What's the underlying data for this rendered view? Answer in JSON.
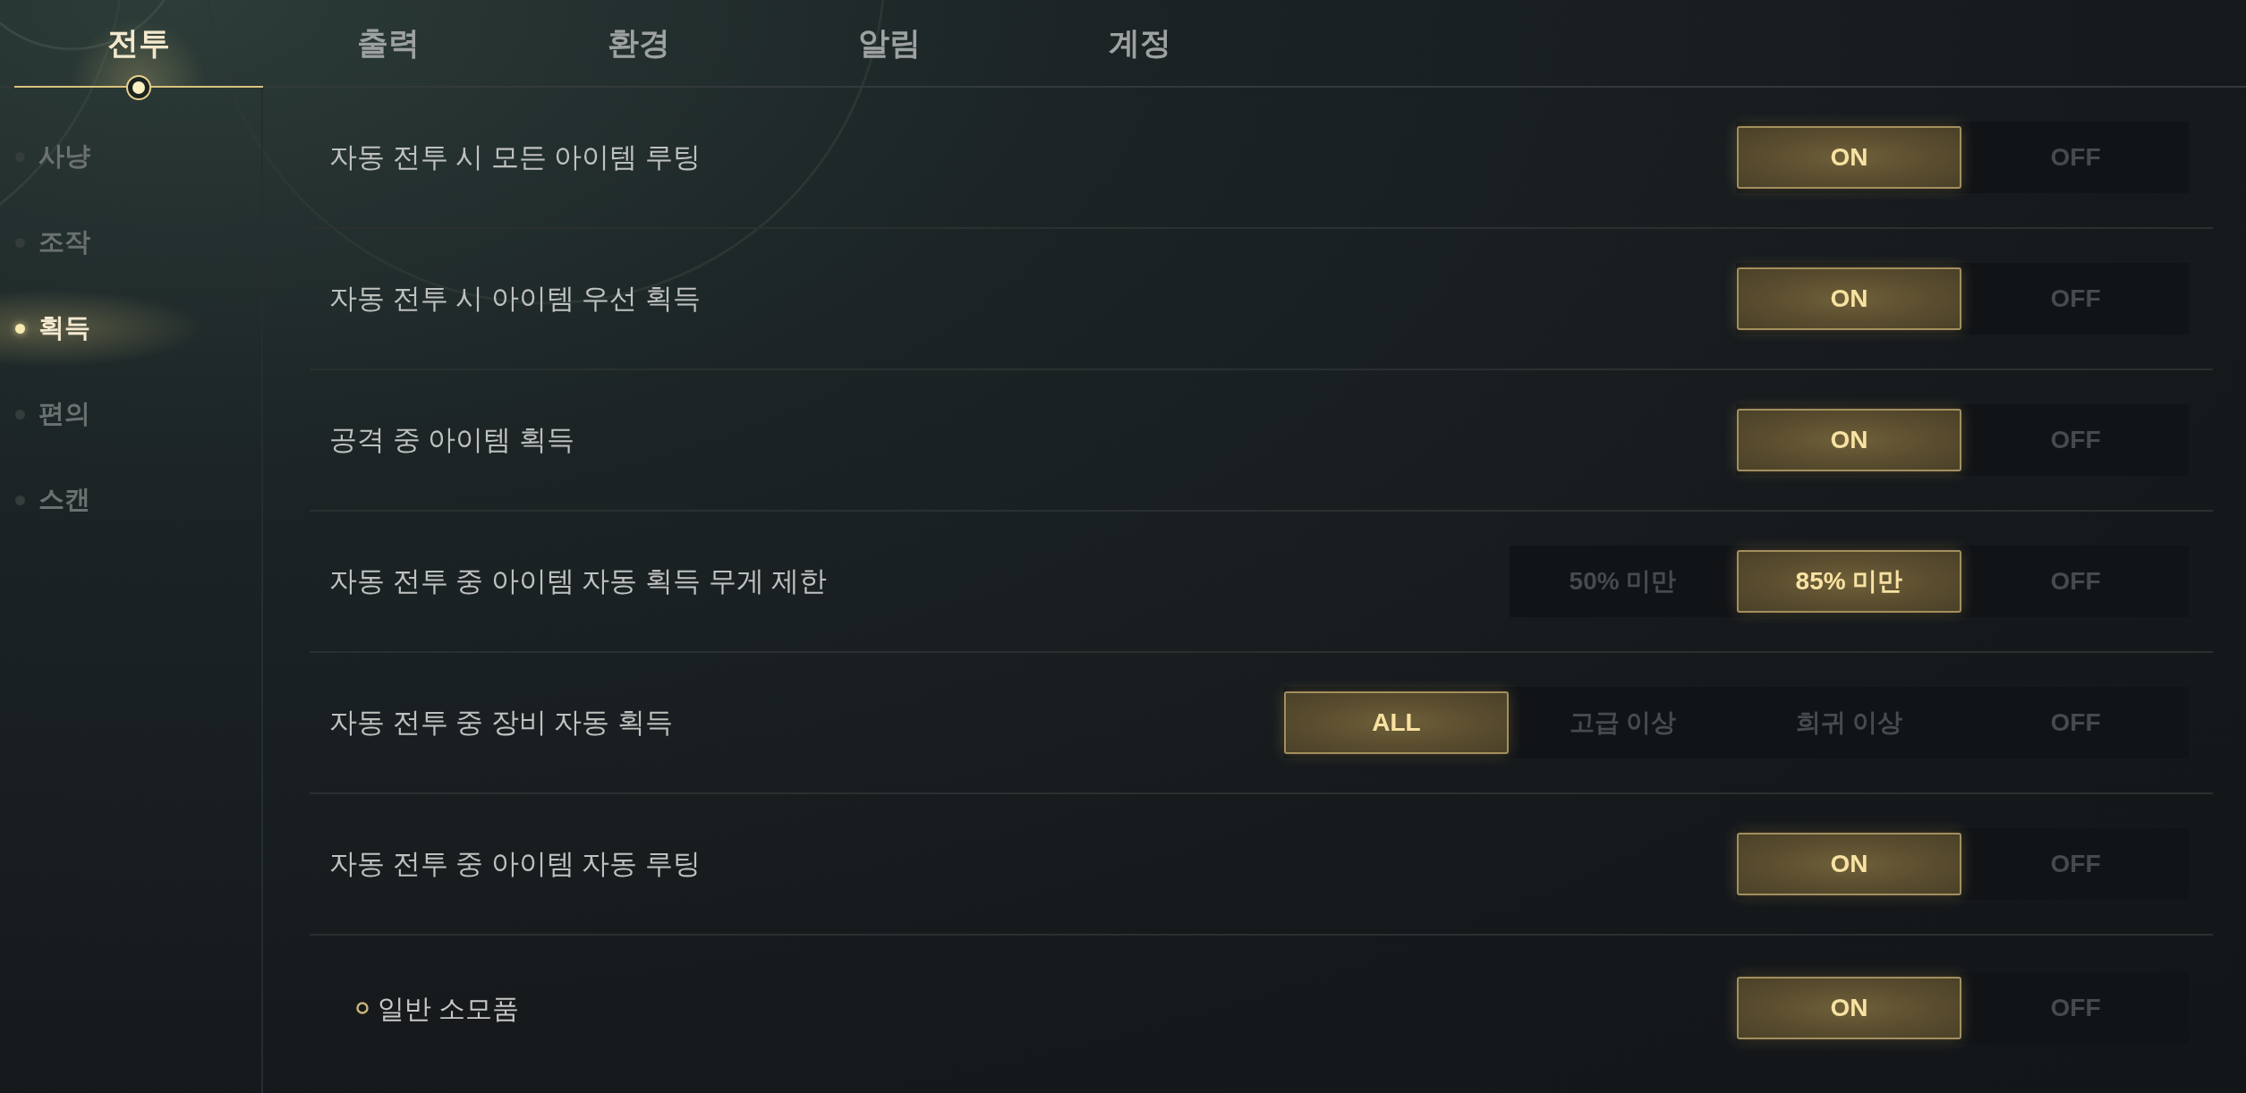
{
  "tabs": [
    {
      "label": "전투",
      "selected": true
    },
    {
      "label": "출력",
      "selected": false
    },
    {
      "label": "환경",
      "selected": false
    },
    {
      "label": "알림",
      "selected": false
    },
    {
      "label": "계정",
      "selected": false
    }
  ],
  "sidebar": {
    "items": [
      {
        "label": "사냥",
        "selected": false
      },
      {
        "label": "조작",
        "selected": false
      },
      {
        "label": "획득",
        "selected": true
      },
      {
        "label": "편의",
        "selected": false
      },
      {
        "label": "스캔",
        "selected": false
      }
    ]
  },
  "settings": [
    {
      "kind": "main",
      "label": "자동 전투 시 모든 아이템 루팅",
      "options": [
        {
          "label": "ON",
          "selected": true
        },
        {
          "label": "OFF",
          "selected": false
        }
      ]
    },
    {
      "kind": "main",
      "label": "자동 전투 시 아이템 우선 획득",
      "options": [
        {
          "label": "ON",
          "selected": true
        },
        {
          "label": "OFF",
          "selected": false
        }
      ]
    },
    {
      "kind": "main",
      "label": "공격 중 아이템 획득",
      "options": [
        {
          "label": "ON",
          "selected": true
        },
        {
          "label": "OFF",
          "selected": false
        }
      ]
    },
    {
      "kind": "main",
      "label": "자동 전투 중 아이템 자동 획득 무게 제한",
      "options": [
        {
          "label": "50% 미만",
          "selected": false
        },
        {
          "label": "85% 미만",
          "selected": true
        },
        {
          "label": "OFF",
          "selected": false
        }
      ]
    },
    {
      "kind": "main",
      "label": "자동 전투 중 장비 자동 획득",
      "options": [
        {
          "label": "ALL",
          "selected": true
        },
        {
          "label": "고급 이상",
          "selected": false
        },
        {
          "label": "희귀 이상",
          "selected": false
        },
        {
          "label": "OFF",
          "selected": false
        }
      ]
    },
    {
      "kind": "main",
      "label": "자동 전투 중 아이템 자동 루팅",
      "options": [
        {
          "label": "ON",
          "selected": true
        },
        {
          "label": "OFF",
          "selected": false
        }
      ]
    },
    {
      "kind": "sub",
      "label": "일반 소모품",
      "options": [
        {
          "label": "ON",
          "selected": true
        },
        {
          "label": "OFF",
          "selected": false
        }
      ]
    }
  ]
}
